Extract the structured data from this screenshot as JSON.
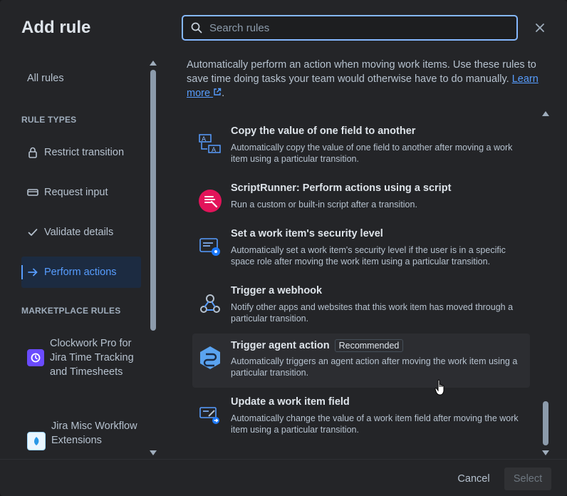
{
  "modal": {
    "title": "Add rule",
    "search": {
      "placeholder": "Search rules",
      "value": ""
    },
    "close_icon": "close-icon"
  },
  "sidebar": {
    "all_rules": "All rules",
    "rule_types_heading": "RULE TYPES",
    "rule_types": [
      {
        "label": "Restrict transition",
        "icon": "lock-icon"
      },
      {
        "label": "Request input",
        "icon": "input-icon"
      },
      {
        "label": "Validate details",
        "icon": "check-icon"
      },
      {
        "label": "Perform actions",
        "icon": "arrow-right-icon",
        "active": true
      }
    ],
    "marketplace_heading": "MARKETPLACE RULES",
    "marketplace": [
      {
        "label": "Clockwork Pro for Jira Time Tracking and Timesheets",
        "icon": "clockwork-logo-icon"
      },
      {
        "label": "Jira Misc Workflow Extensions",
        "icon": "jmwe-logo-icon"
      }
    ]
  },
  "main": {
    "description": "Automatically perform an action when moving work items. Use these rules to save time doing tasks your team would otherwise have to do manually.",
    "learn_more": "Learn more",
    "rules": [
      {
        "title": "Copy the value of one field to another",
        "description": "Automatically copy the value of one field to another after moving a work item using a particular transition.",
        "icon": "copy-field-icon"
      },
      {
        "title": "ScriptRunner: Perform actions using a script",
        "description": "Run a custom or built-in script after a transition.",
        "icon": "scriptrunner-icon"
      },
      {
        "title": "Set a work item's security level",
        "description": "Automatically set a work item's security level if the user is in a specific space role after moving the work item using a particular transition.",
        "icon": "security-level-icon"
      },
      {
        "title": "Trigger a webhook",
        "description": "Notify other apps and websites that this work item has moved through a particular transition.",
        "icon": "webhook-icon"
      },
      {
        "title": "Trigger agent action",
        "badge": "Recommended",
        "description": "Automatically triggers an agent action after moving the work item using a particular transition.",
        "icon": "agent-icon"
      },
      {
        "title": "Update a work item field",
        "description": "Automatically change the value of a work item field after moving the work item using a particular transition.",
        "icon": "update-field-icon"
      }
    ]
  },
  "footer": {
    "cancel": "Cancel",
    "select": "Select"
  }
}
